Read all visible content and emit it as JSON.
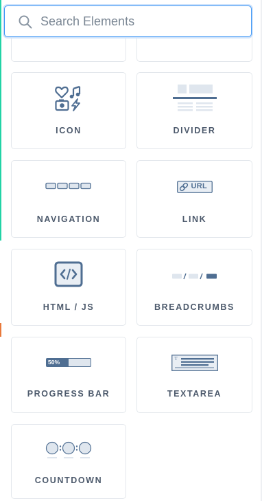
{
  "search": {
    "placeholder": "Search Elements",
    "value": ""
  },
  "colors": {
    "accent": "#3b95f5",
    "icon_dark": "#4f6e92",
    "icon_light": "#dfe6ee",
    "label": "#4d5a6c",
    "card_border": "#e3e7ec"
  },
  "elements": [
    {
      "label": "ICON",
      "icon": "icon-icon"
    },
    {
      "label": "DIVIDER",
      "icon": "divider-icon"
    },
    {
      "label": "NAVIGATION",
      "icon": "navigation-icon"
    },
    {
      "label": "LINK",
      "icon": "link-icon",
      "icon_text": "URL"
    },
    {
      "label": "HTML / JS",
      "icon": "code-icon"
    },
    {
      "label": "BREADCRUMBS",
      "icon": "breadcrumbs-icon"
    },
    {
      "label": "PROGRESS BAR",
      "icon": "progress-bar-icon",
      "icon_text": "50%",
      "progress": 0.5
    },
    {
      "label": "TEXTAREA",
      "icon": "textarea-icon",
      "icon_text": "T"
    },
    {
      "label": "COUNTDOWN",
      "icon": "countdown-icon"
    }
  ]
}
